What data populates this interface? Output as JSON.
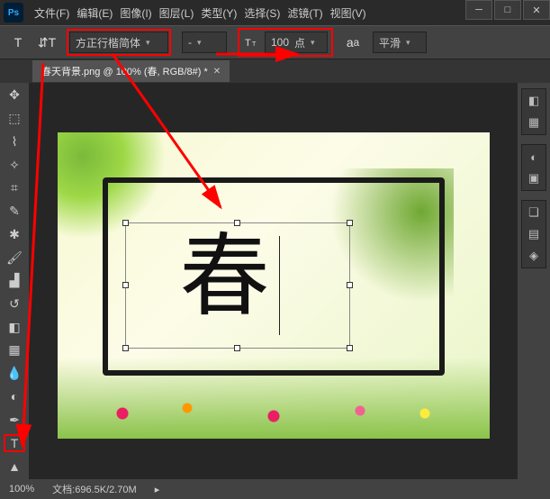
{
  "app": {
    "logo": "Ps"
  },
  "menu": {
    "file": "文件(F)",
    "edit": "编辑(E)",
    "image": "图像(I)",
    "layer": "图层(L)",
    "type": "类型(Y)",
    "select": "选择(S)",
    "filter": "滤镜(T)",
    "view": "视图(V)"
  },
  "options": {
    "font_family": "方正行楷简体",
    "font_size_value": "100",
    "font_size_unit": "点",
    "aa_label": "平滑"
  },
  "tab": {
    "title": "春天背景.png @ 100% (春, RGB/8#) *"
  },
  "canvas": {
    "text": "春"
  },
  "status": {
    "zoom": "100%",
    "doc_label": "文档:",
    "doc_size": "696.5K/2.70M"
  }
}
